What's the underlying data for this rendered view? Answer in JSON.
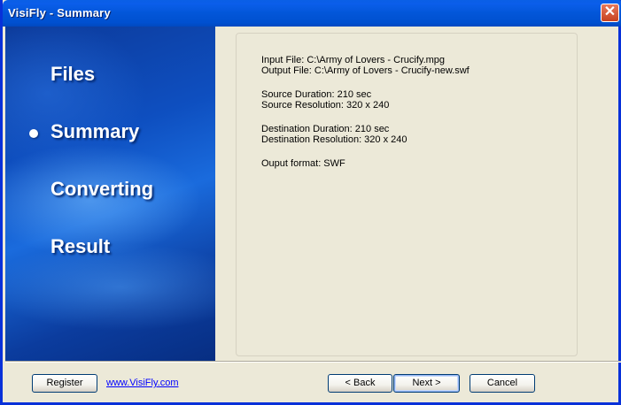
{
  "window": {
    "title": "VisiFly - Summary",
    "close_label": "✕"
  },
  "steps": [
    {
      "label": "Files",
      "active": false
    },
    {
      "label": "Summary",
      "active": true
    },
    {
      "label": "Converting",
      "active": false
    },
    {
      "label": "Result",
      "active": false
    }
  ],
  "summary": {
    "input_file": "Input File: C:\\Army of Lovers - Crucify.mpg",
    "output_file": "Output File: C:\\Army of Lovers - Crucify-new.swf",
    "source_duration": "Source Duration: 210 sec",
    "source_resolution": "Source Resolution: 320 x 240",
    "destination_duration": "Destination Duration: 210 sec",
    "destination_resolution": "Destination Resolution: 320 x 240",
    "output_format": "Ouput format: SWF"
  },
  "footer": {
    "register_label": "Register",
    "website_link": "www.VisiFly.com",
    "back_label": "< Back",
    "next_label": "Next >",
    "cancel_label": "Cancel"
  },
  "colors": {
    "titlebar": "#0256D8",
    "sidebar": "#0E4FC0",
    "dialog_bg": "#ECE9D8",
    "link": "#0000FF"
  }
}
